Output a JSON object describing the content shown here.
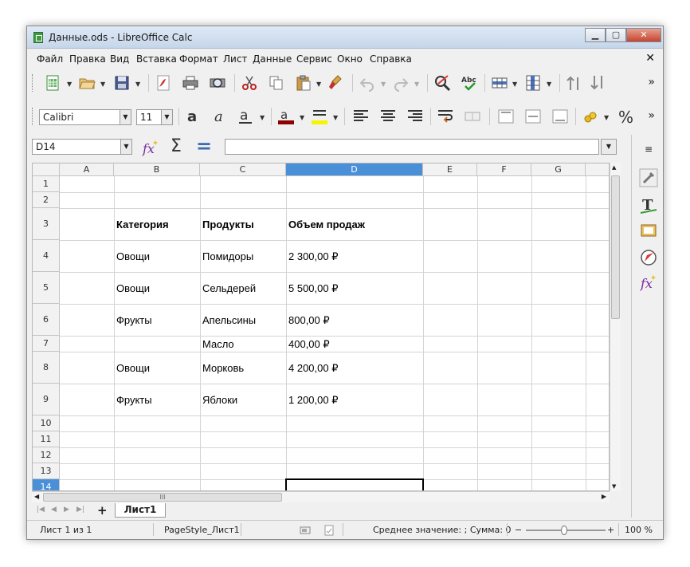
{
  "window": {
    "title": "Данные.ods - LibreOffice Calc",
    "minimize": "▁",
    "maximize": "▢",
    "close": "✕"
  },
  "menu": [
    "Файл",
    "Правка",
    "Вид",
    "Вставка",
    "Формат",
    "Лист",
    "Данные",
    "Сервис",
    "Окно",
    "Справка"
  ],
  "menu_close": "✕",
  "formatting": {
    "font_name": "Calibri",
    "font_size": "11",
    "percent": "%"
  },
  "overflow": "»",
  "formula_bar": {
    "cell_ref": "D14",
    "sum_icon": "Σ",
    "equals_icon": "=",
    "content": ""
  },
  "columns": [
    "A",
    "B",
    "C",
    "D",
    "E",
    "F",
    "G"
  ],
  "rows": [
    "1",
    "2",
    "3",
    "4",
    "5",
    "6",
    "7",
    "8",
    "9",
    "10",
    "11",
    "12",
    "13",
    "14"
  ],
  "cells": {
    "B3": "Категория",
    "C3": "Продукты",
    "D3": "Объем продаж",
    "B4": "Овощи",
    "C4": "Помидоры",
    "D4": "2 300,00 ₽",
    "B5": "Овощи",
    "C5": "Сельдерей",
    "D5": "5 500,00 ₽",
    "B6": "Фрукты",
    "C6": "Апельсины",
    "D6": "800,00 ₽",
    "C7": "Масло",
    "D7": "400,00 ₽",
    "B8": "Овощи",
    "C8": "Морковь",
    "D8": "4 200,00 ₽",
    "B9": "Фрукты",
    "C9": "Яблоки",
    "D9": "1 200,00 ₽"
  },
  "sheet_tabs": {
    "add": "+",
    "active": "Лист1"
  },
  "hscroll_thumb": "III",
  "status": {
    "sheet": "Лист 1 из 1",
    "page_style": "PageStyle_Лист1",
    "summary": "Среднее значение: ; Сумма: 0",
    "zoom_minus": "−",
    "zoom_plus": "+",
    "zoom": "100 %"
  },
  "colors": {
    "selection": "#4a90d9",
    "title_gradient_top": "#dfe9f5"
  }
}
